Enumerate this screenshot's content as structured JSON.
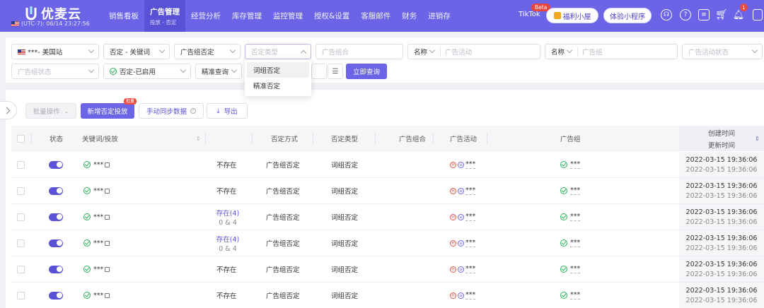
{
  "header": {
    "logo_text": "优麦云",
    "timezone": "(UTC-7): 06/14 23:27:56",
    "nav": [
      {
        "label": "销售看板"
      },
      {
        "label": "广告管理",
        "sub": "投放 - 否定"
      },
      {
        "label": "经营分析"
      },
      {
        "label": "库存管理"
      },
      {
        "label": "监控管理"
      },
      {
        "label": "授权&设置"
      },
      {
        "label": "客服邮件"
      },
      {
        "label": "财务"
      },
      {
        "label": "进销存"
      }
    ],
    "tiktok": "TikTok",
    "beta": "Beta",
    "welfare_label": "福利小屋",
    "miniprogram_label": "体验小程序",
    "notification_count": "1"
  },
  "filters": {
    "site": "***- 美国站",
    "negative_type_scope": "否定 - 关键词",
    "level": "广告组否定",
    "negative_type_placeholder": "否定类型",
    "ad_group_combo_placeholder": "广告组合",
    "name1_label": "名称",
    "campaign_placeholder": "广告活动",
    "name2_label": "名称",
    "ad_group_placeholder": "广告组",
    "campaign_status_placeholder": "广告活动状态",
    "ad_group_status_placeholder": "广告组状态",
    "status_value": "否定-已启用",
    "match_mode": "精准查询",
    "query_button": "立即查询",
    "dropdown_options": [
      "词组否定",
      "精准否定"
    ]
  },
  "toolbar": {
    "batch_label": "批量操作",
    "add_label": "新增否定投放",
    "add_badge": "批量",
    "sync_label": "手动同步数据",
    "export_label": "导出"
  },
  "table": {
    "headers": {
      "status": "状态",
      "keyword": "关键词/投放",
      "method": "否定方式",
      "type": "否定类型",
      "combo": "广告组合",
      "campaign": "广告活动",
      "group": "广告组",
      "created": "创建时间",
      "updated": "更新时间"
    },
    "rows": [
      {
        "keyword": "***",
        "exist": "不存在",
        "exist_sub": "",
        "method": "广告组否定",
        "type": "词组否定",
        "campaign": "***",
        "group": "***",
        "created": "2022-03-15 19:36:06",
        "updated": "2022-03-15 19:36:06"
      },
      {
        "keyword": "***",
        "exist": "不存在",
        "exist_sub": "",
        "method": "广告组否定",
        "type": "词组否定",
        "campaign": "***",
        "group": "***",
        "created": "2022-03-15 19:36:06",
        "updated": "2022-03-15 19:36:06"
      },
      {
        "keyword": "***",
        "exist": "存在(4)",
        "exist_sub": "0 & 4",
        "method": "广告组否定",
        "type": "词组否定",
        "campaign": "***",
        "group": "***",
        "created": "2022-03-15 19:36:06",
        "updated": "2022-03-15 19:36:06"
      },
      {
        "keyword": "***",
        "exist": "存在(4)",
        "exist_sub": "0 & 4",
        "method": "广告组否定",
        "type": "词组否定",
        "campaign": "***",
        "group": "***",
        "created": "2022-03-15 19:36:06",
        "updated": "2022-03-15 19:36:06"
      },
      {
        "keyword": "***",
        "exist": "不存在",
        "exist_sub": "",
        "method": "广告组否定",
        "type": "词组否定",
        "campaign": "***",
        "group": "***",
        "created": "2022-03-15 19:36:06",
        "updated": "2022-03-15 19:36:06"
      },
      {
        "keyword": "***",
        "exist": "不存在",
        "exist_sub": "",
        "method": "广告组否定",
        "type": "词组否定",
        "campaign": "***",
        "group": "***",
        "created": "2022-03-15 19:36:06",
        "updated": "2022-03-15 19:36:06"
      }
    ]
  },
  "colors": {
    "brand": "#6b64e6",
    "accent_dark": "#5a52d6",
    "enabled_green": "#29b35a",
    "badge_red": "#f04a3f"
  },
  "icons": [
    "logo-u-icon",
    "us-flag-icon",
    "house-icon",
    "headset-icon",
    "help-icon",
    "message-icon",
    "cart-icon",
    "bell-icon",
    "chevron-down-icon",
    "list-icon",
    "export-icon",
    "question-icon",
    "external-link-icon",
    "check-circle-icon",
    "sort-icon"
  ]
}
